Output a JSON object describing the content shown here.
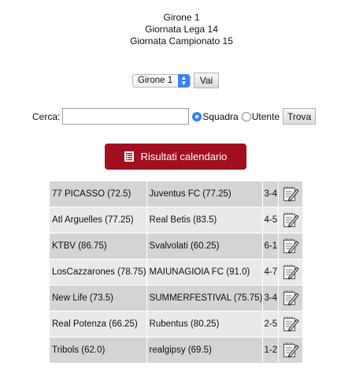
{
  "header": {
    "line1": "Girone 1",
    "line2": "Giornata Lega 14",
    "line3": "Giornata Campionato 15"
  },
  "group_select": {
    "value": "Girone 1"
  },
  "go_button": "Vai",
  "search": {
    "label": "Cerca:",
    "value": "",
    "radio_team": "Squadra",
    "radio_user": "Utente",
    "selected": "Squadra",
    "button": "Trova"
  },
  "calendar_button": "Risultati calendario",
  "colors": {
    "accent": "#a10f21",
    "radio_selected": "#3c86f0"
  },
  "matches": [
    {
      "home": "77 PICASSO (72.5)",
      "away": "Juventus FC (77.25)",
      "score": "3-4",
      "icon": "edit-icon"
    },
    {
      "home": "Atl Arguelles (77.25)",
      "away": "Real Betis (83.5)",
      "score": "4-5",
      "icon": "edit-icon"
    },
    {
      "home": "KTBV (86.75)",
      "away": "Svalvolati (60.25)",
      "score": "6-1",
      "icon": "edit-icon"
    },
    {
      "home": "LosCazzarones (78.75)",
      "away": "MAIUNAGIOIA FC (91.0)",
      "score": "4-7",
      "icon": "edit-icon"
    },
    {
      "home": "New Life (73.5)",
      "away": "SUMMERFESTIVAL (75.75)",
      "score": "3-4",
      "icon": "edit-icon"
    },
    {
      "home": "Real Potenza (66.25)",
      "away": "Rubentus (80.25)",
      "score": "2-5",
      "icon": "edit-icon"
    },
    {
      "home": "Tribols (62.0)",
      "away": "realgipsy (69.5)",
      "score": "1-2",
      "icon": "edit-icon"
    }
  ]
}
